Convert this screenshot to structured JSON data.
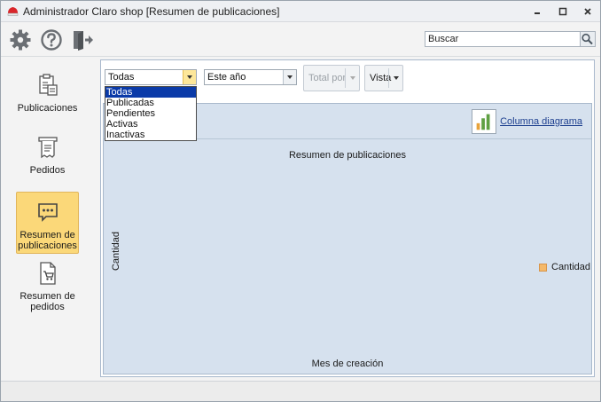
{
  "window": {
    "title": "Administrador Claro shop [Resumen de publicaciones]",
    "icons": [
      "app-icon",
      "minimize-icon",
      "maximize-icon",
      "close-icon"
    ]
  },
  "toolbar": {
    "icons": [
      "gear-icon",
      "help-icon",
      "exit-icon"
    ],
    "search_placeholder": "Buscar"
  },
  "sidebar": {
    "items": [
      {
        "label": "Publicaciones",
        "icon": "clipboard-icon"
      },
      {
        "label": "Pedidos",
        "icon": "receipt-icon"
      },
      {
        "label": "Resumen de publicaciones",
        "icon": "chat-bubble-icon",
        "active": true
      },
      {
        "label": "Resumen de pedidos",
        "icon": "cart-document-icon"
      }
    ]
  },
  "filters": {
    "status_selected": "Todas",
    "period_selected": "Este año",
    "total_por": "Total por",
    "vista": "Vista",
    "status_options": [
      "Todas",
      "Publicadas",
      "Pendientes",
      "Activas",
      "Inactivas"
    ]
  },
  "chart": {
    "type_label": "Columna diagrama"
  },
  "chart_data": {
    "type": "bar",
    "title": "Resumen de publicaciones",
    "xlabel": "Mes de creación",
    "ylabel": "Cantidad",
    "categories": [],
    "series": [
      {
        "name": "Cantidad",
        "values": []
      }
    ],
    "legend": "right",
    "colors": {
      "Cantidad": "#f5b96a"
    },
    "background": "#d6e1ee"
  }
}
